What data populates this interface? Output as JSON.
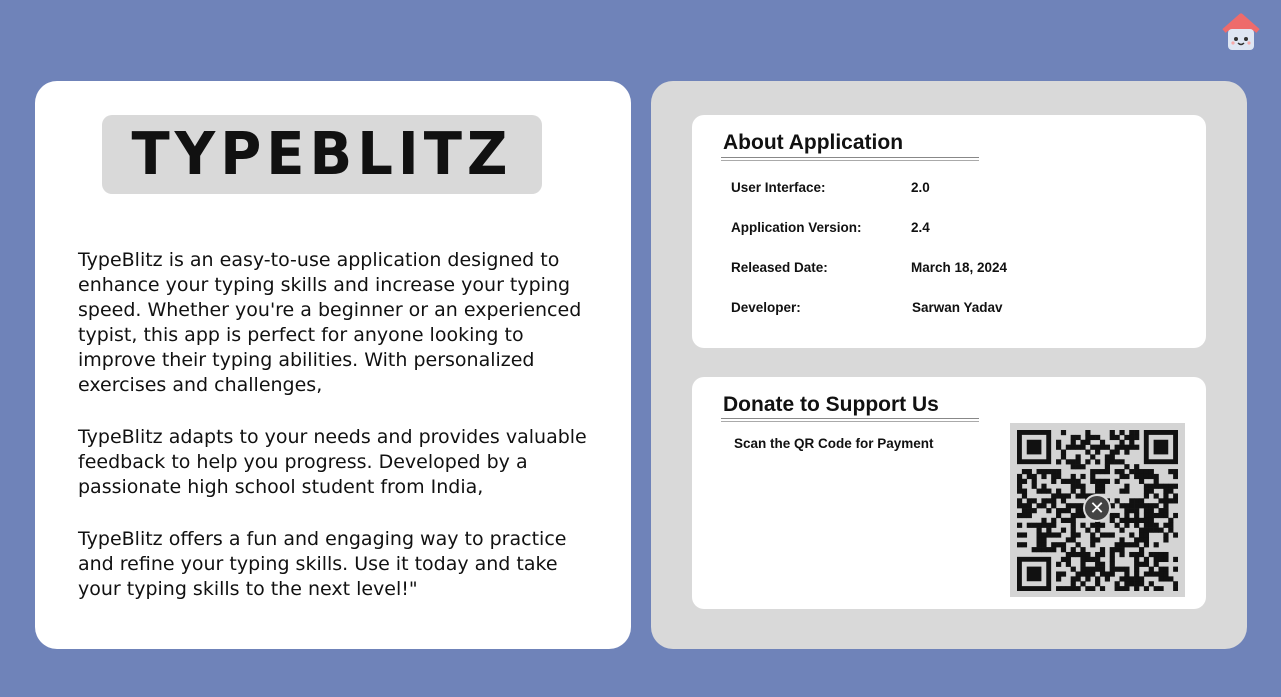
{
  "app": {
    "title": "TYPEBLITZ",
    "home_icon": "home-icon"
  },
  "description": {
    "paragraphs": [
      "TypeBlitz is an easy-to-use application designed to enhance your typing skills and increase your typing speed. Whether you're a beginner or an experienced typist, this app is perfect for anyone looking to improve their typing abilities. With personalized exercises and challenges,",
      "TypeBlitz adapts to your needs and provides valuable feedback to help you progress. Developed by a passionate high school student from India,",
      "TypeBlitz offers a fun and engaging way to practice and refine your typing skills. Use it today and take your typing skills to the next level!\""
    ]
  },
  "about": {
    "title": "About Application",
    "rows": [
      {
        "label": "User Interface:",
        "value": "2.0"
      },
      {
        "label": "Application Version:",
        "value": "2.4"
      },
      {
        "label": "Released Date:",
        "value": "March 18, 2024"
      },
      {
        "label": "Developer:",
        "value": "Sarwan Yadav"
      }
    ]
  },
  "donate": {
    "title": "Donate to Support Us",
    "scan_text": "Scan the QR Code for Payment",
    "qr_icon": "qr-code-icon",
    "close_icon": "close-icon",
    "close_glyph": "✕"
  },
  "colors": {
    "background": "#6f83b9",
    "left_panel": "#ffffff",
    "right_panel": "#d9d9d9",
    "title_box": "#d9d9d9",
    "card": "#ffffff"
  }
}
